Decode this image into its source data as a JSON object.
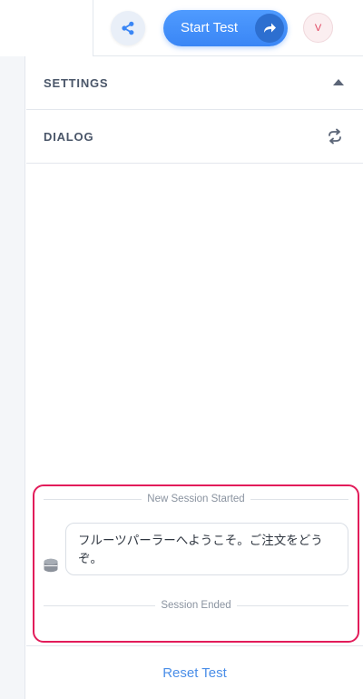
{
  "toolbar": {
    "share_icon": "share-icon",
    "start_label": "Start Test",
    "start_icon": "forward-arrow-icon",
    "avatar_initial": "V",
    "accent_color": "#3a86f5"
  },
  "panel": {
    "settings_title": "SETTINGS",
    "settings_icon": "chevron-up-icon",
    "dialog_title": "DIALOG",
    "dialog_icon": "refresh-icon"
  },
  "session": {
    "started_label": "New Session Started",
    "ended_label": "Session Ended",
    "highlight_color": "#e21c5a",
    "messages": [
      {
        "sender_icon": "bot-icon",
        "text": "フルーツパーラーへようこそ。ご注文をどうぞ。"
      }
    ]
  },
  "footer": {
    "reset_label": "Reset Test"
  }
}
